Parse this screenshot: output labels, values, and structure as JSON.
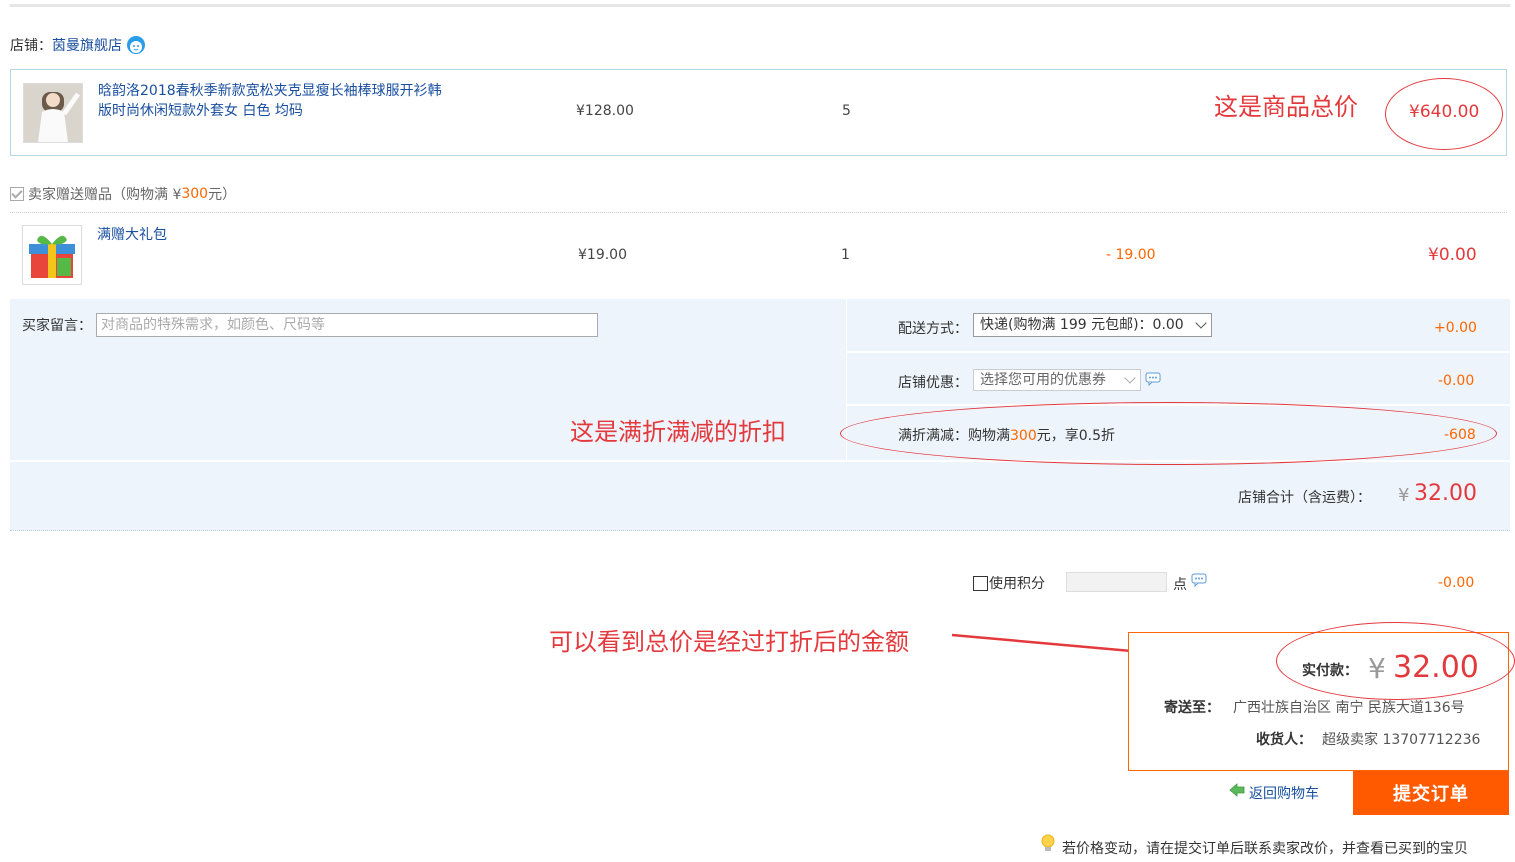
{
  "shop": {
    "label": "店铺：",
    "name": "茵曼旗舰店"
  },
  "item1": {
    "name_line1": "晗韵洛2018春秋季新款宽松夹克显瘦长袖棒球服开衫韩",
    "name_line2": "版时尚休闲短款外套女 白色 均码",
    "price": "¥128.00",
    "qty": "5",
    "total": "¥640.00"
  },
  "gift": {
    "label_prefix": "卖家赠送赠品（购物满 ¥",
    "label_amount": "300",
    "label_suffix": " 元）",
    "name": "满赠大礼包",
    "price": "¥19.00",
    "qty": "1",
    "discount": "- 19.00",
    "total": "¥0.00"
  },
  "buyer_message": {
    "label": "买家留言：",
    "placeholder": "对商品的特殊需求，如颜色、尺码等"
  },
  "shipping": {
    "label": "配送方式：",
    "selected": "快递(购物满 199 元包邮)：0.00",
    "amount": "+0.00"
  },
  "coupon": {
    "label": "店铺优惠：",
    "selected": "选择您可用的优惠券",
    "amount": "-0.00"
  },
  "promo": {
    "label": "满折满减：",
    "text_prefix": "购物满",
    "text_amount": "300",
    "text_suffix": "元，享0.5折",
    "amount": "-608"
  },
  "shop_total": {
    "label": "店铺合计（含运费）：",
    "currency": "¥",
    "value": "32.00"
  },
  "points": {
    "label": "使用积分",
    "unit": "点",
    "amount": "-0.00"
  },
  "payment": {
    "label": "实付款：",
    "currency": "¥",
    "value": "32.00",
    "ship_to_label": "寄送至：",
    "ship_to": "广西壮族自治区 南宁 民族大道136号",
    "receiver_label": "收货人：",
    "receiver": "超级卖家 13707712236"
  },
  "actions": {
    "back_cart": "返回购物车",
    "submit": "提交订单"
  },
  "notice": "若价格变动，请在提交订单后联系卖家改价，并查看已买到的宝贝",
  "annotations": {
    "total_note": "这是商品总价",
    "discount_note": "这是满折满减的折扣",
    "paid_note": "可以看到总价是经过打折后的金额"
  },
  "colors": {
    "accent_red": "#e4393c",
    "accent_orange": "#ff5a00",
    "link_blue": "#1a4fa0",
    "panel_blue": "#eef4fb"
  }
}
